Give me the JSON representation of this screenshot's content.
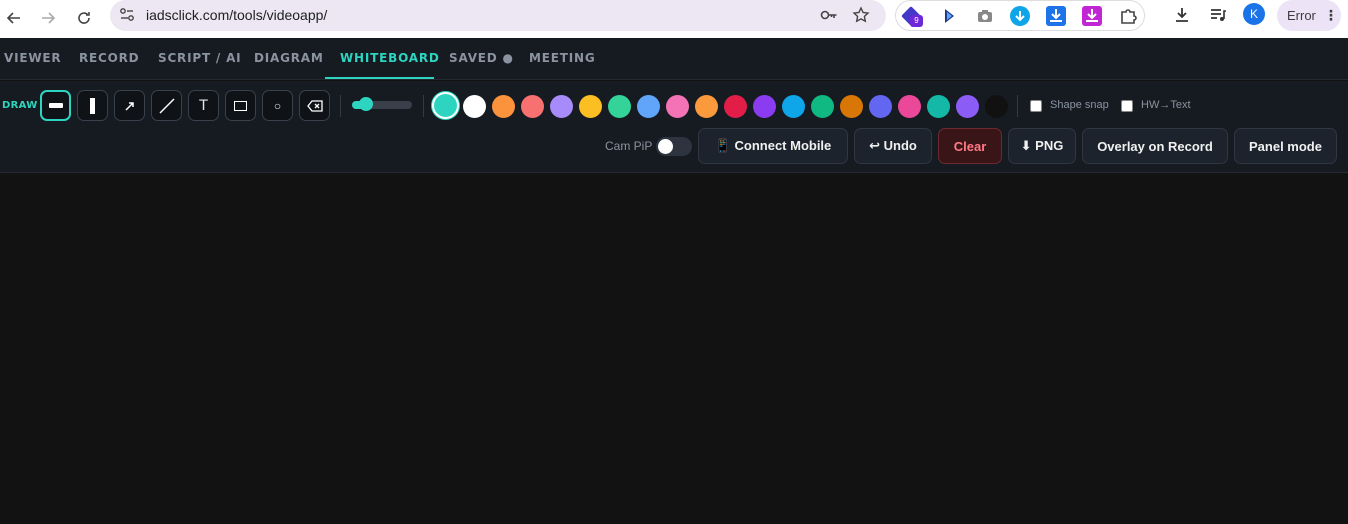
{
  "browser": {
    "url": "iadsclick.com/tools/videoapp/",
    "avatar_initial": "K",
    "error_label": "Error",
    "extension_badge": "9"
  },
  "tabs": [
    {
      "label": "VIEWER"
    },
    {
      "label": "RECORD"
    },
    {
      "label": "SCRIPT / AI"
    },
    {
      "label": "DIAGRAM"
    },
    {
      "label": "WHITEBOARD"
    },
    {
      "label": "SAVED ●"
    },
    {
      "label": "MEETING"
    }
  ],
  "active_tab": "WHITEBOARD",
  "toolbar": {
    "draw_label": "DRAW",
    "text_tool_glyph": "T",
    "circle_tool_glyph": "○",
    "stroke_size_fraction": 0.15,
    "colors": [
      "#2dd4bf",
      "#ffffff",
      "#fb923c",
      "#f87171",
      "#a78bfa",
      "#fbbf24",
      "#34d399",
      "#60a5fa",
      "#f472b6",
      "#fb9a3c",
      "#e11d48",
      "#8b3cf0",
      "#0ea5e9",
      "#10b981",
      "#d97706",
      "#6366f1",
      "#ec4899",
      "#14b8a6",
      "#8b5cf6",
      "#111111"
    ],
    "active_color": "#2dd4bf",
    "shape_snap_label": "Shape snap",
    "hw_text_label": "HW→Text",
    "cam_pip_label": "Cam PiP",
    "connect_mobile_label": "📱 Connect Mobile",
    "undo_label": "↩ Undo",
    "clear_label": "Clear",
    "png_label": "⬇ PNG",
    "overlay_label": "Overlay on Record",
    "panel_mode_label": "Panel mode"
  },
  "accent_color": "#2dd4bf"
}
